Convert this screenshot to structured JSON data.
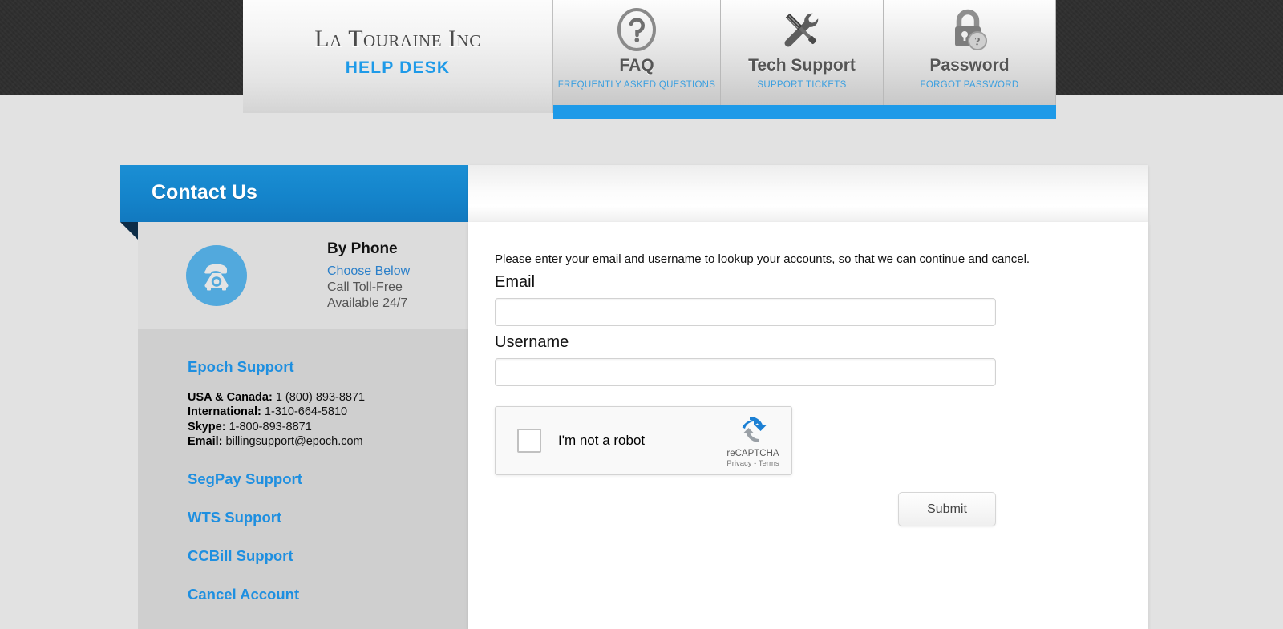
{
  "header": {
    "logo_title": "La Touraine Inc",
    "logo_subtitle": "HELP DESK",
    "tabs": [
      {
        "label": "FAQ",
        "sublabel": "FREQUENTLY ASKED QUESTIONS",
        "icon": "question-circle-icon"
      },
      {
        "label": "Tech Support",
        "sublabel": "SUPPORT TICKETS",
        "icon": "wrench-screwdriver-icon"
      },
      {
        "label": "Password",
        "sublabel": "FORGOT PASSWORD",
        "icon": "padlock-question-icon"
      }
    ]
  },
  "banner": {
    "title": "Contact Us"
  },
  "sidebar": {
    "phone": {
      "icon": "telephone-icon",
      "heading": "By Phone",
      "link": "Choose Below",
      "line1": "Call Toll-Free",
      "line2": "Available 24/7"
    },
    "links": [
      {
        "label": "Epoch Support"
      },
      {
        "label": "SegPay Support"
      },
      {
        "label": "WTS Support"
      },
      {
        "label": "CCBill Support"
      },
      {
        "label": "Cancel Account"
      }
    ],
    "epoch_details": [
      {
        "label": "USA & Canada:",
        "value": "1 (800) 893-8871"
      },
      {
        "label": "International:",
        "value": "1-310-664-5810"
      },
      {
        "label": "Skype:",
        "value": "1-800-893-8871"
      },
      {
        "label": "Email:",
        "value": "billingsupport@epoch.com"
      }
    ]
  },
  "form": {
    "intro": "Please enter your email and username to lookup your accounts, so that we can continue and cancel.",
    "email_label": "Email",
    "email_value": "",
    "email_placeholder": "",
    "username_label": "Username",
    "username_value": "",
    "username_placeholder": "",
    "submit_label": "Submit"
  },
  "recaptcha": {
    "label": "I'm not a robot",
    "brand": "reCAPTCHA",
    "terms": "Privacy - Terms",
    "checked": false
  },
  "colors": {
    "accent_blue": "#1e9ae8",
    "banner_blue": "#1484cb",
    "link_blue": "#1e8fe0",
    "dark_band": "#2e2e2e",
    "page_background": "#e2e2e2",
    "sidebar_gray": "#cfcfcf"
  }
}
